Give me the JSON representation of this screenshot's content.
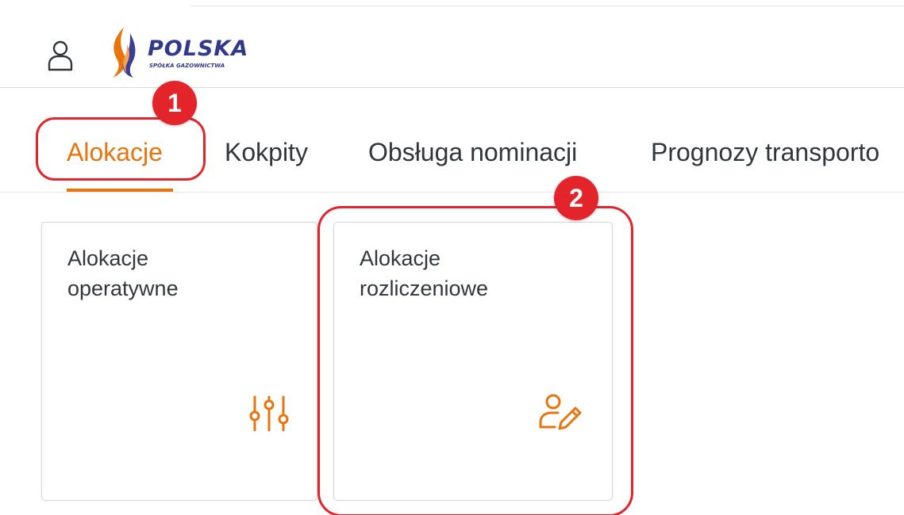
{
  "header": {
    "logo": {
      "title": "POLSKA",
      "subtitle": "SPÓŁKA GAZOWNICTWA"
    }
  },
  "tabs": [
    {
      "label": "Alokacje",
      "active": true
    },
    {
      "label": "Kokpity",
      "active": false
    },
    {
      "label": "Obsługa nominacji",
      "active": false
    },
    {
      "label": "Prognozy transporto",
      "active": false
    }
  ],
  "tiles": [
    {
      "title_line1": "Alokacje",
      "title_line2": "operatywne",
      "icon": "sliders-icon"
    },
    {
      "title_line1": "Alokacje",
      "title_line2": "rozliczeniowe",
      "icon": "user-edit-icon"
    }
  ],
  "callouts": [
    {
      "number": "1"
    },
    {
      "number": "2"
    }
  ],
  "colors": {
    "accent": "#e9730c",
    "callout": "#e3242b",
    "logo_blue": "#2f3a8c"
  }
}
